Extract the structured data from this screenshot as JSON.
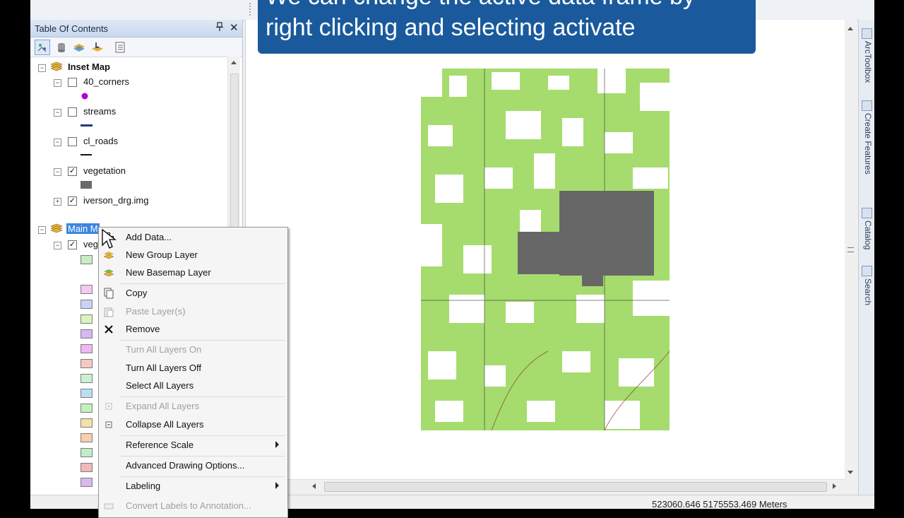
{
  "toc": {
    "title": "Table Of Contents",
    "pin_glyph": "∙",
    "close_glyph": "✕"
  },
  "tree": {
    "inset_map": "Inset Map",
    "layers": [
      {
        "label": "40_corners",
        "checked": false,
        "legend": "point",
        "color": "#b000d8"
      },
      {
        "label": "streams",
        "checked": false,
        "legend": "line",
        "color": "#1e3a7a"
      },
      {
        "label": "cl_roads",
        "checked": false,
        "legend": "line",
        "color": "#111111"
      },
      {
        "label": "vegetation",
        "checked": true,
        "legend": "fill",
        "color": "#6a6a6a"
      },
      {
        "label": "iverson_drg.img",
        "checked": true,
        "legend": "none",
        "color": ""
      }
    ],
    "main_map": "Main M",
    "main_layer": "veg",
    "swatch_colors": [
      "#c7eec3",
      "#f3c9f3",
      "#c9d3f5",
      "#dbf5b8",
      "#d4b8f2",
      "#f1b8ef",
      "#f5c9c1",
      "#c9f2d2",
      "#b9def6",
      "#c2f0bf",
      "#f5e0a9",
      "#f6cfb0",
      "#bfeec8",
      "#f3b8b8",
      "#d6b9f1"
    ]
  },
  "menu": {
    "items": [
      {
        "label": "Add Data...",
        "disabled": false,
        "icon": "add-data-icon",
        "sub": false
      },
      {
        "label": "New Group Layer",
        "disabled": false,
        "icon": "group-layer-icon",
        "sub": false
      },
      {
        "label": "New Basemap Layer",
        "disabled": false,
        "icon": "basemap-icon",
        "sub": false
      },
      {
        "label": "Copy",
        "disabled": false,
        "icon": "copy-icon",
        "sub": false
      },
      {
        "label": "Paste Layer(s)",
        "disabled": true,
        "icon": "paste-icon",
        "sub": false
      },
      {
        "label": "Remove",
        "disabled": false,
        "icon": "remove-icon",
        "sub": false
      },
      {
        "label": "Turn All Layers On",
        "disabled": true,
        "icon": "",
        "sub": false
      },
      {
        "label": "Turn All Layers Off",
        "disabled": false,
        "icon": "",
        "sub": false
      },
      {
        "label": "Select All Layers",
        "disabled": false,
        "icon": "",
        "sub": false
      },
      {
        "label": "Expand All Layers",
        "disabled": true,
        "icon": "expand-icon",
        "sub": false
      },
      {
        "label": "Collapse All Layers",
        "disabled": false,
        "icon": "collapse-icon",
        "sub": false
      },
      {
        "label": "Reference Scale",
        "disabled": false,
        "icon": "",
        "sub": true
      },
      {
        "label": "Advanced Drawing Options...",
        "disabled": false,
        "icon": "",
        "sub": false
      },
      {
        "label": "Labeling",
        "disabled": false,
        "icon": "",
        "sub": true
      },
      {
        "label": "Convert Labels to Annotation...",
        "disabled": true,
        "icon": "convert-icon",
        "sub": false
      }
    ]
  },
  "banner": {
    "line1": "We can change the active data frame by",
    "line2": "right clicking and selecting activate"
  },
  "dock": {
    "tabs": [
      "ArcToolbox",
      "Create Features",
      "Catalog",
      "Search"
    ]
  },
  "status": {
    "coords": "523060.646  5175553.469 Meters"
  },
  "colors": {
    "map_green": "#a6dc6e",
    "selection_blue": "#3a86e0",
    "banner_blue": "#1a5a9c"
  }
}
